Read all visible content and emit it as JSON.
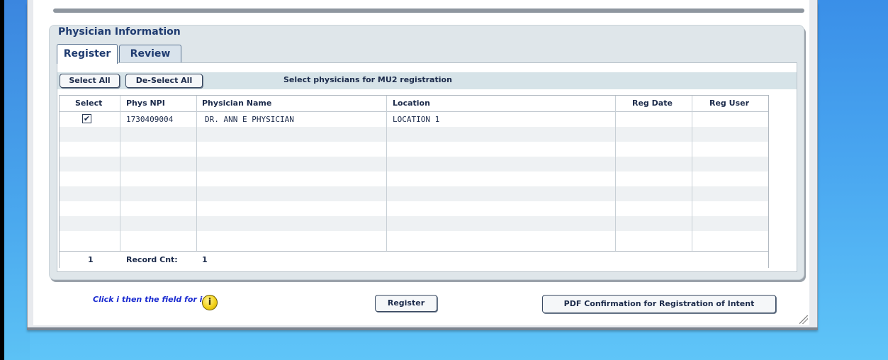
{
  "panel": {
    "title": "Physician Information",
    "tabs": [
      {
        "label": "Register",
        "active": true
      },
      {
        "label": "Review",
        "active": false
      }
    ]
  },
  "toolbar": {
    "select_all": "Select All",
    "deselect_all": "De-Select All",
    "instruction": "Select physicians for MU2 registration"
  },
  "table": {
    "columns": [
      "Select",
      "Phys NPI",
      "Physician Name",
      "Location",
      "Reg Date",
      "Reg User"
    ],
    "rows": [
      {
        "select": "✔",
        "npi": "1730409004",
        "name": "DR. ANN E PHYSICIAN",
        "location": "LOCATION 1",
        "reg_date": "",
        "reg_user": ""
      }
    ],
    "footer": {
      "count": "1",
      "record_label": "Record Cnt:",
      "record_value": "1"
    }
  },
  "footer": {
    "info_text": "Click i then the field for info",
    "info_icon": "i",
    "register_button": "Register",
    "pdf_button": "PDF Confirmation for Registration of Intent"
  },
  "icons": {
    "info": "info-icon",
    "check": "checkbox-checked-icon",
    "grip": "resize-grip-icon"
  }
}
